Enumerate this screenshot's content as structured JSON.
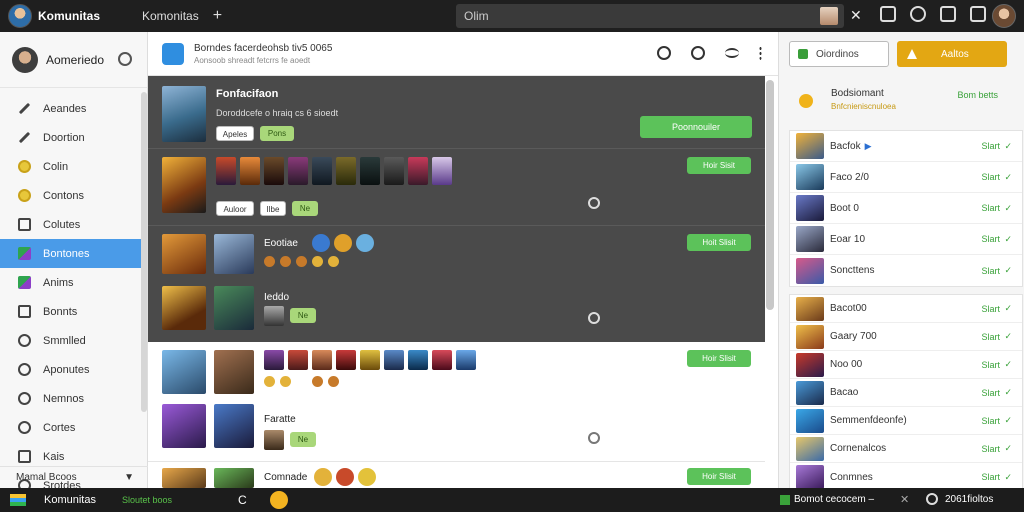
{
  "topbar": {
    "app_name": "Komunitas",
    "tab_label": "Komonitas",
    "search_value": "Olim",
    "close_symbol": "✕"
  },
  "sidebar": {
    "user_name": "Aomeriedo",
    "items": [
      {
        "label": "Aeandes",
        "icon": "pen-icon"
      },
      {
        "label": "Doortion",
        "icon": "brush-icon"
      },
      {
        "label": "Colin",
        "icon": "coin-icon"
      },
      {
        "label": "Contons",
        "icon": "coin-icon"
      },
      {
        "label": "Colutes",
        "icon": "grid-icon"
      },
      {
        "label": "Bontones",
        "icon": "game-icon"
      },
      {
        "label": "Anims",
        "icon": "game-icon"
      },
      {
        "label": "Bonnts",
        "icon": "list-icon"
      },
      {
        "label": "Smmlled",
        "icon": "circle-icon"
      },
      {
        "label": "Aponutes",
        "icon": "user-icon"
      },
      {
        "label": "Nemnos",
        "icon": "circle-icon"
      },
      {
        "label": "Cortes",
        "icon": "circle-icon"
      },
      {
        "label": "Kais",
        "icon": "square-icon"
      },
      {
        "label": "Srotdes",
        "icon": "circle-icon"
      }
    ],
    "active_index": 5,
    "footer": "Mamal Bcoos"
  },
  "main": {
    "header_title": "Borndes facerdeohsb tiv5 0065",
    "header_sub": "Aonsoob shreadt fetcrrs fe aoedt",
    "featured": {
      "title": "Fonfacifaon",
      "sub": "Doroddcefe o hraiq cs 6 sioedt",
      "chip1": "Apeles",
      "chip2": "Pons",
      "button": "Poonnouiler"
    },
    "rows": [
      {
        "chip1": "Auloor",
        "chip2": "Ilbe",
        "chip3": "Ne",
        "button": "Hoir Sisit"
      },
      {
        "label_a": "Eootiae",
        "label_b": "Ieddo",
        "chip": "Ne",
        "button": "Hoit Slisit"
      },
      {
        "chip": "Ne",
        "label": "Faratte",
        "button": "Hoir Slisit"
      },
      {
        "label": "Comnade",
        "button": "Hoir Slisit"
      }
    ]
  },
  "right": {
    "btn1": "Oiordinos",
    "btn2": "Aaltos",
    "promo_title": "Bodsiomant",
    "promo_sub": "Bnfcnieniscnuloea",
    "promo_link": "Bom betts",
    "list1": [
      {
        "name": "Bacfok",
        "start": "Slart"
      },
      {
        "name": "Faco 2/0",
        "start": "Slart"
      },
      {
        "name": "Boot 0",
        "start": "Slart"
      },
      {
        "name": "Eoar 10",
        "start": "Slart"
      },
      {
        "name": "Soncttens",
        "start": "Slart"
      }
    ],
    "list2": [
      {
        "name": "Bacot00",
        "start": "Slart"
      },
      {
        "name": "Gaary 700",
        "start": "Slart"
      },
      {
        "name": "Noo 00",
        "start": "Slart"
      },
      {
        "name": "Bacao",
        "start": "Slart"
      },
      {
        "name": "Semmenfdeonfe)",
        "start": "Slart"
      },
      {
        "name": "Cornenalcos",
        "start": "Slart"
      },
      {
        "name": "Conmnes",
        "start": "Slart"
      }
    ]
  },
  "taskbar": {
    "app": "Komunitas",
    "status": "Sloutet boos",
    "letter": "C",
    "right1": "Bomot cecocem –",
    "right2": "2061fioltos"
  },
  "colors": {
    "accent_blue": "#4a9be8",
    "start_green": "#3aa23a",
    "button_green": "#5cc25a",
    "gold": "#e3a713",
    "dark_row": "#4a4a4a"
  }
}
